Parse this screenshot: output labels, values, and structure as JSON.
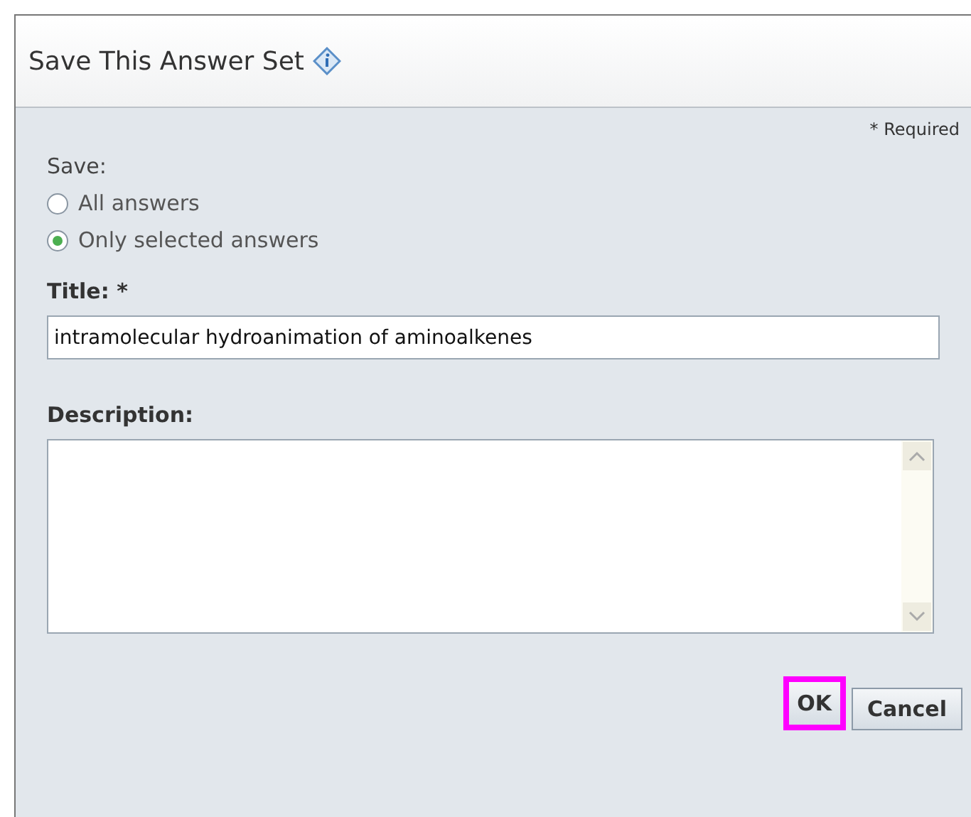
{
  "dialog": {
    "title": "Save This Answer Set",
    "required_note": "* Required",
    "save": {
      "label": "Save:",
      "options": [
        {
          "label": "All answers",
          "selected": false
        },
        {
          "label": "Only selected answers",
          "selected": true
        }
      ]
    },
    "title_field": {
      "label": "Title: *",
      "value": "intramolecular hydroanimation of aminoalkenes"
    },
    "description_field": {
      "label": "Description:"
    },
    "buttons": [
      {
        "label": "OK",
        "highlighted": true
      },
      {
        "label": "Cancel",
        "highlighted": false
      }
    ]
  }
}
